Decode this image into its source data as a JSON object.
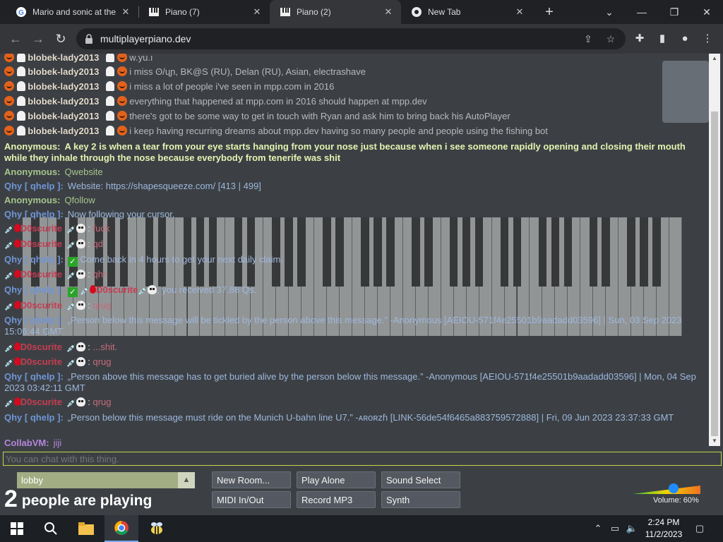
{
  "browser": {
    "tabs": [
      {
        "title": "Mario and sonic at the",
        "icon": "google-icon",
        "active": false
      },
      {
        "title": "Piano (7)",
        "icon": "piano-icon",
        "active": false
      },
      {
        "title": "Piano (2)",
        "icon": "piano-icon",
        "active": true
      },
      {
        "title": "New Tab",
        "icon": "chrome-icon",
        "active": false
      }
    ],
    "url": "multiplayerpiano.dev"
  },
  "chat": {
    "messages": [
      {
        "name": "blobek-lady2013",
        "text": "w.yu.ı",
        "type": "blob"
      },
      {
        "name": "blobek-lady2013",
        "text": "i miss ʘ/ɥɲ, BK@S (RU), Delan (RU), Asian, electrashave",
        "type": "blob"
      },
      {
        "name": "blobek-lady2013",
        "text": "i miss a lot of people i've seen in mpp.com in 2016",
        "type": "blob"
      },
      {
        "name": "blobek-lady2013",
        "text": "everything that happened at mpp.com in 2016 should happen at mpp.dev",
        "type": "blob"
      },
      {
        "name": "blobek-lady2013",
        "text": "there's got to be some way to get in touch with Ryan and ask him to bring back his AutoPlayer",
        "type": "blob"
      },
      {
        "name": "blobek-lady2013",
        "text": "i keep having recurring dreams about mpp.dev having so many people and people using the fishing bot",
        "type": "blob"
      },
      {
        "name": "Anonymous:",
        "text": "A key 2 is when a tear from your eye starts hanging from your nose just because when i see someone rapidly opening and closing their mouth while they inhale through the nose because everybody from tenerife was shit",
        "type": "anon-y"
      },
      {
        "name": "Anonymous:",
        "text": "Qwebsite",
        "type": "anon"
      },
      {
        "name": "Qhy [ qhelp ]:",
        "text": "Website: https://shapesqueeze.com/ [413 | 499]",
        "type": "qhy"
      },
      {
        "name": "Anonymous:",
        "text": "Qfollow",
        "type": "anon"
      },
      {
        "name": "Qhy [ qhelp ]:",
        "text": "Now following your cursor.",
        "type": "qhy"
      },
      {
        "name": "D0scurite",
        "text": "fuck",
        "type": "dos"
      },
      {
        "name": "D0scurite",
        "text": "qd",
        "type": "dos"
      },
      {
        "name": "Qhy [ qhelp ]:",
        "text": "Come back in 4 hours to get your next daily claim.",
        "type": "qhy"
      },
      {
        "name": "D0scurite",
        "text": "qhr",
        "type": "dos"
      },
      {
        "name": "Qhy [ qhelp ]:",
        "text": "D0scurite",
        "text2": ", you received 37.88 Qs.",
        "type": "qhy-recv"
      },
      {
        "name": "D0scurite",
        "text": "qrug",
        "type": "dos"
      },
      {
        "name": "Qhy [ qhelp ]:",
        "text": "„Person below this message will be tickled by the person above this message.” -Anonymous [AEIOU-571f4e25501b9aadadd03596] | Sun, 03 Sep 2023 15:06:44 GMT",
        "type": "qhy"
      },
      {
        "name": "D0scurite",
        "text": "...shit.",
        "type": "dos"
      },
      {
        "name": "D0scurite",
        "text": "qrug",
        "type": "dos"
      },
      {
        "name": "Qhy [ qhelp ]:",
        "text": "„Person above this message has to get buried alive by the person below this message.” -Anonymous [AEIOU-571f4e25501b9aadadd03596] | Mon, 04 Sep 2023 03:42:11 GMT",
        "type": "qhy"
      },
      {
        "name": "D0scurite",
        "text": "qrug",
        "type": "dos"
      },
      {
        "name": "Qhy [ qhelp ]:",
        "text": "„Person below this message must ride on the Munich U-bahn line U7.” -ᴀʀᴏʀᴢɦ [LINK-56de54f6465a883759572888] | Fri, 09 Jun 2023 23:37:33 GMT",
        "type": "qhy"
      },
      {
        "name": "CollabVM:",
        "text": "jiji",
        "type": "cvm"
      }
    ],
    "input_placeholder": "You can chat with this thing."
  },
  "controls": {
    "room": "lobby",
    "player_count": "2",
    "player_text": "people are playing",
    "buttons": [
      "New Room...",
      "Play Alone",
      "Sound Select",
      "MIDI In/Out",
      "Record MP3",
      "Synth"
    ],
    "volume_label": "Volume: 60%",
    "volume": 0.6
  },
  "taskbar": {
    "time": "2:24 PM",
    "date": "11/2/2023"
  }
}
